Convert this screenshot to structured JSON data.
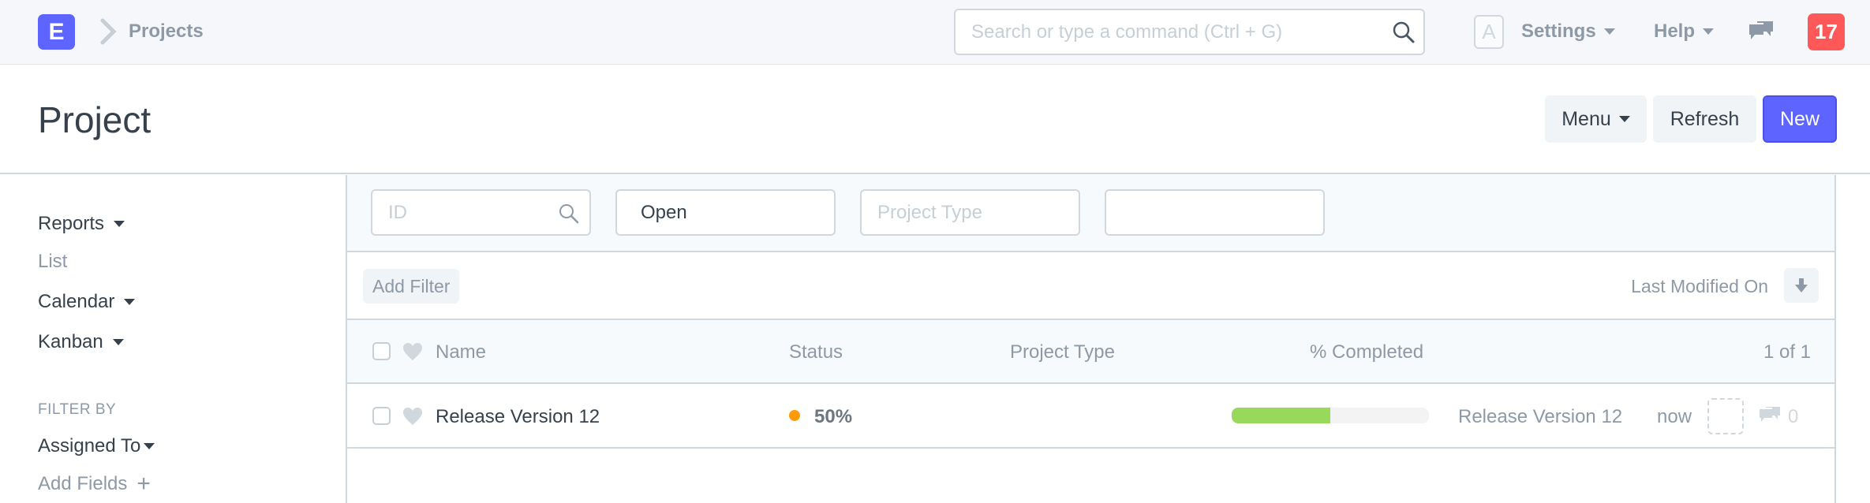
{
  "navbar": {
    "logo_letter": "E",
    "breadcrumb": "Projects",
    "search_placeholder": "Search or type a command (Ctrl + G)",
    "avatar_letter": "A",
    "settings_label": "Settings",
    "help_label": "Help",
    "notification_count": "17"
  },
  "page_head": {
    "title": "Project",
    "menu_label": "Menu",
    "refresh_label": "Refresh",
    "new_label": "New"
  },
  "sidebar": {
    "items": [
      {
        "label": "Reports",
        "dropdown": true
      },
      {
        "label": "List",
        "dropdown": false
      },
      {
        "label": "Calendar",
        "dropdown": true
      },
      {
        "label": "Kanban",
        "dropdown": true
      }
    ],
    "filter_heading": "FILTER BY",
    "assigned_to_label": "Assigned To",
    "add_fields_label": "Add Fields"
  },
  "filters": {
    "id_placeholder": "ID",
    "status_value": "Open",
    "project_type_placeholder": "Project Type",
    "extra_value": "",
    "add_filter_label": "Add Filter",
    "sort_label": "Last Modified On"
  },
  "list": {
    "columns": {
      "name": "Name",
      "status": "Status",
      "project_type": "Project Type",
      "percent_completed": "% Completed",
      "count": "1 of 1"
    },
    "rows": [
      {
        "name": "Release Version 12",
        "status": "50%",
        "status_color": "#ff9c0a",
        "project_type": "",
        "percent_completed": 50,
        "title": "Release Version 12",
        "modified": "now",
        "comment_count": "0"
      }
    ]
  },
  "colors": {
    "primary": "#5e64ff",
    "notification": "#ff5858",
    "progress": "#98d85b"
  }
}
